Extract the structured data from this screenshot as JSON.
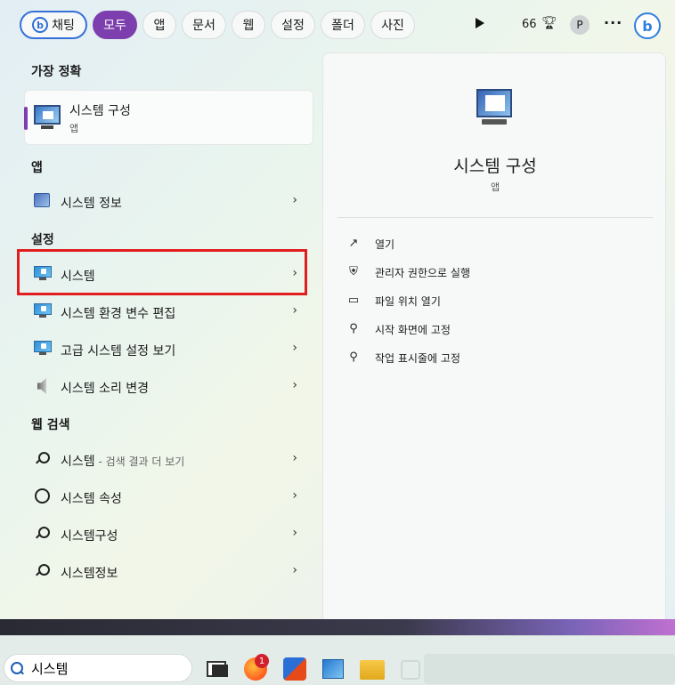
{
  "filters": {
    "chat": "채팅",
    "all": "모두",
    "apps": "앱",
    "documents": "문서",
    "web": "웹",
    "settings": "설정",
    "folders": "폴더",
    "photos": "사진",
    "points": "66",
    "avatar": "P",
    "more": "···",
    "bing": "b"
  },
  "left": {
    "best_match_header": "가장 정확",
    "best_match": {
      "title": "시스템 구성",
      "subtitle": "앱"
    },
    "apps_header": "앱",
    "apps": [
      {
        "label": "시스템 정보"
      }
    ],
    "settings_header": "설정",
    "settings": [
      {
        "label": "시스템"
      },
      {
        "label": "시스템 환경 변수 편집"
      },
      {
        "label": "고급 시스템 설정 보기"
      },
      {
        "label": "시스템 소리 변경"
      }
    ],
    "web_header": "웹 검색",
    "web": [
      {
        "label": "시스템",
        "suffix": " - 검색 결과 더 보기"
      },
      {
        "label": "시스템 속성"
      },
      {
        "label": "시스템구성"
      },
      {
        "label": "시스템정보"
      }
    ],
    "chevron": "›"
  },
  "right": {
    "title": "시스템 구성",
    "subtitle": "앱",
    "actions": [
      {
        "label": "열기",
        "icon": "open-external-icon"
      },
      {
        "label": "관리자 권한으로 실행",
        "icon": "shield-icon"
      },
      {
        "label": "파일 위치 열기",
        "icon": "folder-icon"
      },
      {
        "label": "시작 화면에 고정",
        "icon": "pin-icon"
      },
      {
        "label": "작업 표시줄에 고정",
        "icon": "pin-icon"
      }
    ]
  },
  "taskbar": {
    "search_value": "시스템",
    "firefox_badge": "1"
  },
  "colors": {
    "accent": "#7d3fae",
    "highlight": "#e11d1d",
    "bing": "#2f7fe0"
  }
}
